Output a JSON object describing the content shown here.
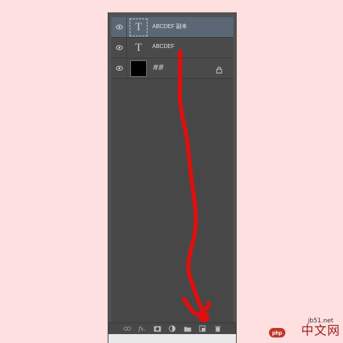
{
  "panel": {
    "layers": [
      {
        "name": "ABCDEF 副本",
        "type": "text",
        "thumb_glyph": "T",
        "selected": true,
        "visible": true,
        "locked": false
      },
      {
        "name": "ABCDEF",
        "type": "text",
        "thumb_glyph": "T",
        "selected": false,
        "visible": true,
        "locked": false
      },
      {
        "name": "背景",
        "type": "background",
        "thumb_glyph": "",
        "selected": false,
        "visible": true,
        "locked": true
      }
    ],
    "toolbar": {
      "fx_label": "fx."
    }
  },
  "colors": {
    "page_bg": "#fde0df",
    "panel_bg": "#535353",
    "selected_row": "#5b6775",
    "annotation_stroke": "#e10e0e"
  },
  "icons": [
    "eye-icon",
    "lock-icon",
    "link-icon",
    "fx-icon",
    "mask-icon",
    "adjustment-icon",
    "folder-icon",
    "new-layer-icon",
    "trash-icon"
  ],
  "watermark": {
    "url": "jb51.net",
    "badge": "php",
    "brand": "中文网"
  }
}
